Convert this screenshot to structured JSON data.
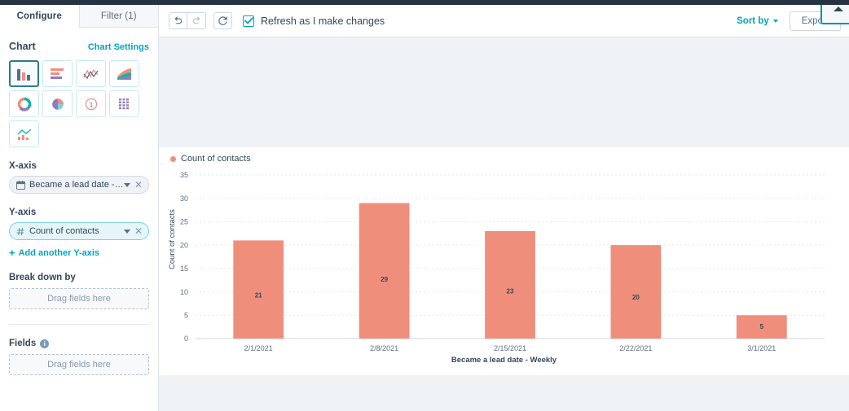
{
  "tabs": [
    {
      "label": "Configure",
      "active": true
    },
    {
      "label": "Filter (1)",
      "active": false
    }
  ],
  "sidebar": {
    "chart_section": {
      "title": "Chart",
      "settings_link": "Chart Settings",
      "types": [
        {
          "name": "vertical-bar-chart",
          "selected": true
        },
        {
          "name": "horizontal-bar-chart",
          "selected": false
        },
        {
          "name": "line-chart",
          "selected": false
        },
        {
          "name": "area-chart",
          "selected": false
        },
        {
          "name": "donut-chart",
          "selected": false
        },
        {
          "name": "pie-chart",
          "selected": false
        },
        {
          "name": "single-value-chart",
          "selected": false
        },
        {
          "name": "table-chart",
          "selected": false
        },
        {
          "name": "combo-chart",
          "selected": false
        }
      ]
    },
    "x_axis": {
      "label": "X-axis",
      "field": "Became a lead date - Weekly",
      "icon": "calendar-icon"
    },
    "y_axis": {
      "label": "Y-axis",
      "field": "Count of contacts",
      "icon": "number-icon",
      "add_link": "Add another Y-axis"
    },
    "breakdown": {
      "label": "Break down by",
      "dropzone_text": "Drag fields here"
    },
    "fields": {
      "label": "Fields",
      "dropzone_text": "Drag fields here"
    }
  },
  "toolbar": {
    "undo_icon": "undo-icon",
    "redo_icon": "redo-icon",
    "refresh_icon": "refresh-icon",
    "refresh_checkbox_label": "Refresh as I make changes",
    "refresh_checked": true,
    "sort_by_label": "Sort by",
    "export_label": "Export"
  },
  "colors": {
    "bar": "#F08E7C",
    "accent": "#00A4BD",
    "text": "#33475B",
    "toolbar_border": "#DFE3EB",
    "canvas": "#F0F3F5"
  },
  "chart_data": {
    "type": "bar",
    "title": "",
    "legend": [
      "Count of contacts"
    ],
    "legend_position": "top-left",
    "categories": [
      "2/1/2021",
      "2/8/2021",
      "2/15/2021",
      "2/22/2021",
      "3/1/2021"
    ],
    "values": [
      21,
      29,
      23,
      20,
      5
    ],
    "xlabel": "Became a lead date - Weekly",
    "ylabel": "Count of contacts",
    "ylim": [
      0,
      35
    ],
    "yticks": [
      0,
      5,
      10,
      15,
      20,
      25,
      30,
      35
    ],
    "grid": true,
    "bar_color": "#F08E7C",
    "data_labels": true
  }
}
